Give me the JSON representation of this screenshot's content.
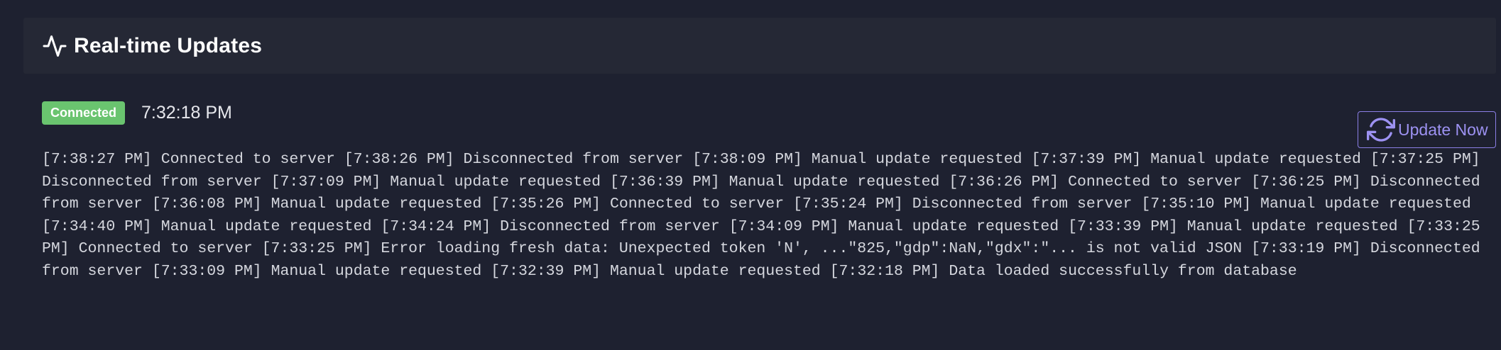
{
  "panel": {
    "title": "Real-time Updates",
    "title_icon": "pulse-icon"
  },
  "status": {
    "badge": "Connected",
    "badge_color": "#6ac46f",
    "last_update_time": "7:32:18 PM"
  },
  "actions": {
    "update_button_label": "Update Now",
    "update_button_icon": "refresh-icon",
    "accent_color": "#8b7fe6"
  },
  "log": [
    "[7:38:27 PM] Connected to server",
    "[7:38:26 PM] Disconnected from server",
    "[7:38:09 PM] Manual update requested",
    "[7:37:39 PM] Manual update requested",
    "[7:37:25 PM] Disconnected from server",
    "[7:37:09 PM] Manual update requested",
    "[7:36:39 PM] Manual update requested",
    "[7:36:26 PM] Connected to server",
    "[7:36:25 PM] Disconnected from server",
    "[7:36:08 PM] Manual update requested",
    "[7:35:26 PM] Connected to server",
    "[7:35:24 PM] Disconnected from server",
    "[7:35:10 PM] Manual update requested",
    "[7:34:40 PM] Manual update requested",
    "[7:34:24 PM] Disconnected from server",
    "[7:34:09 PM] Manual update requested",
    "[7:33:39 PM] Manual update requested",
    "[7:33:25 PM] Connected to server",
    "[7:33:25 PM] Error loading fresh data: Unexpected token 'N', ...\"825,\"gdp\":NaN,\"gdx\":\"... is not valid JSON",
    "[7:33:19 PM] Disconnected from server",
    "[7:33:09 PM] Manual update requested",
    "[7:32:39 PM] Manual update requested",
    "[7:32:18 PM] Data loaded successfully from database"
  ]
}
